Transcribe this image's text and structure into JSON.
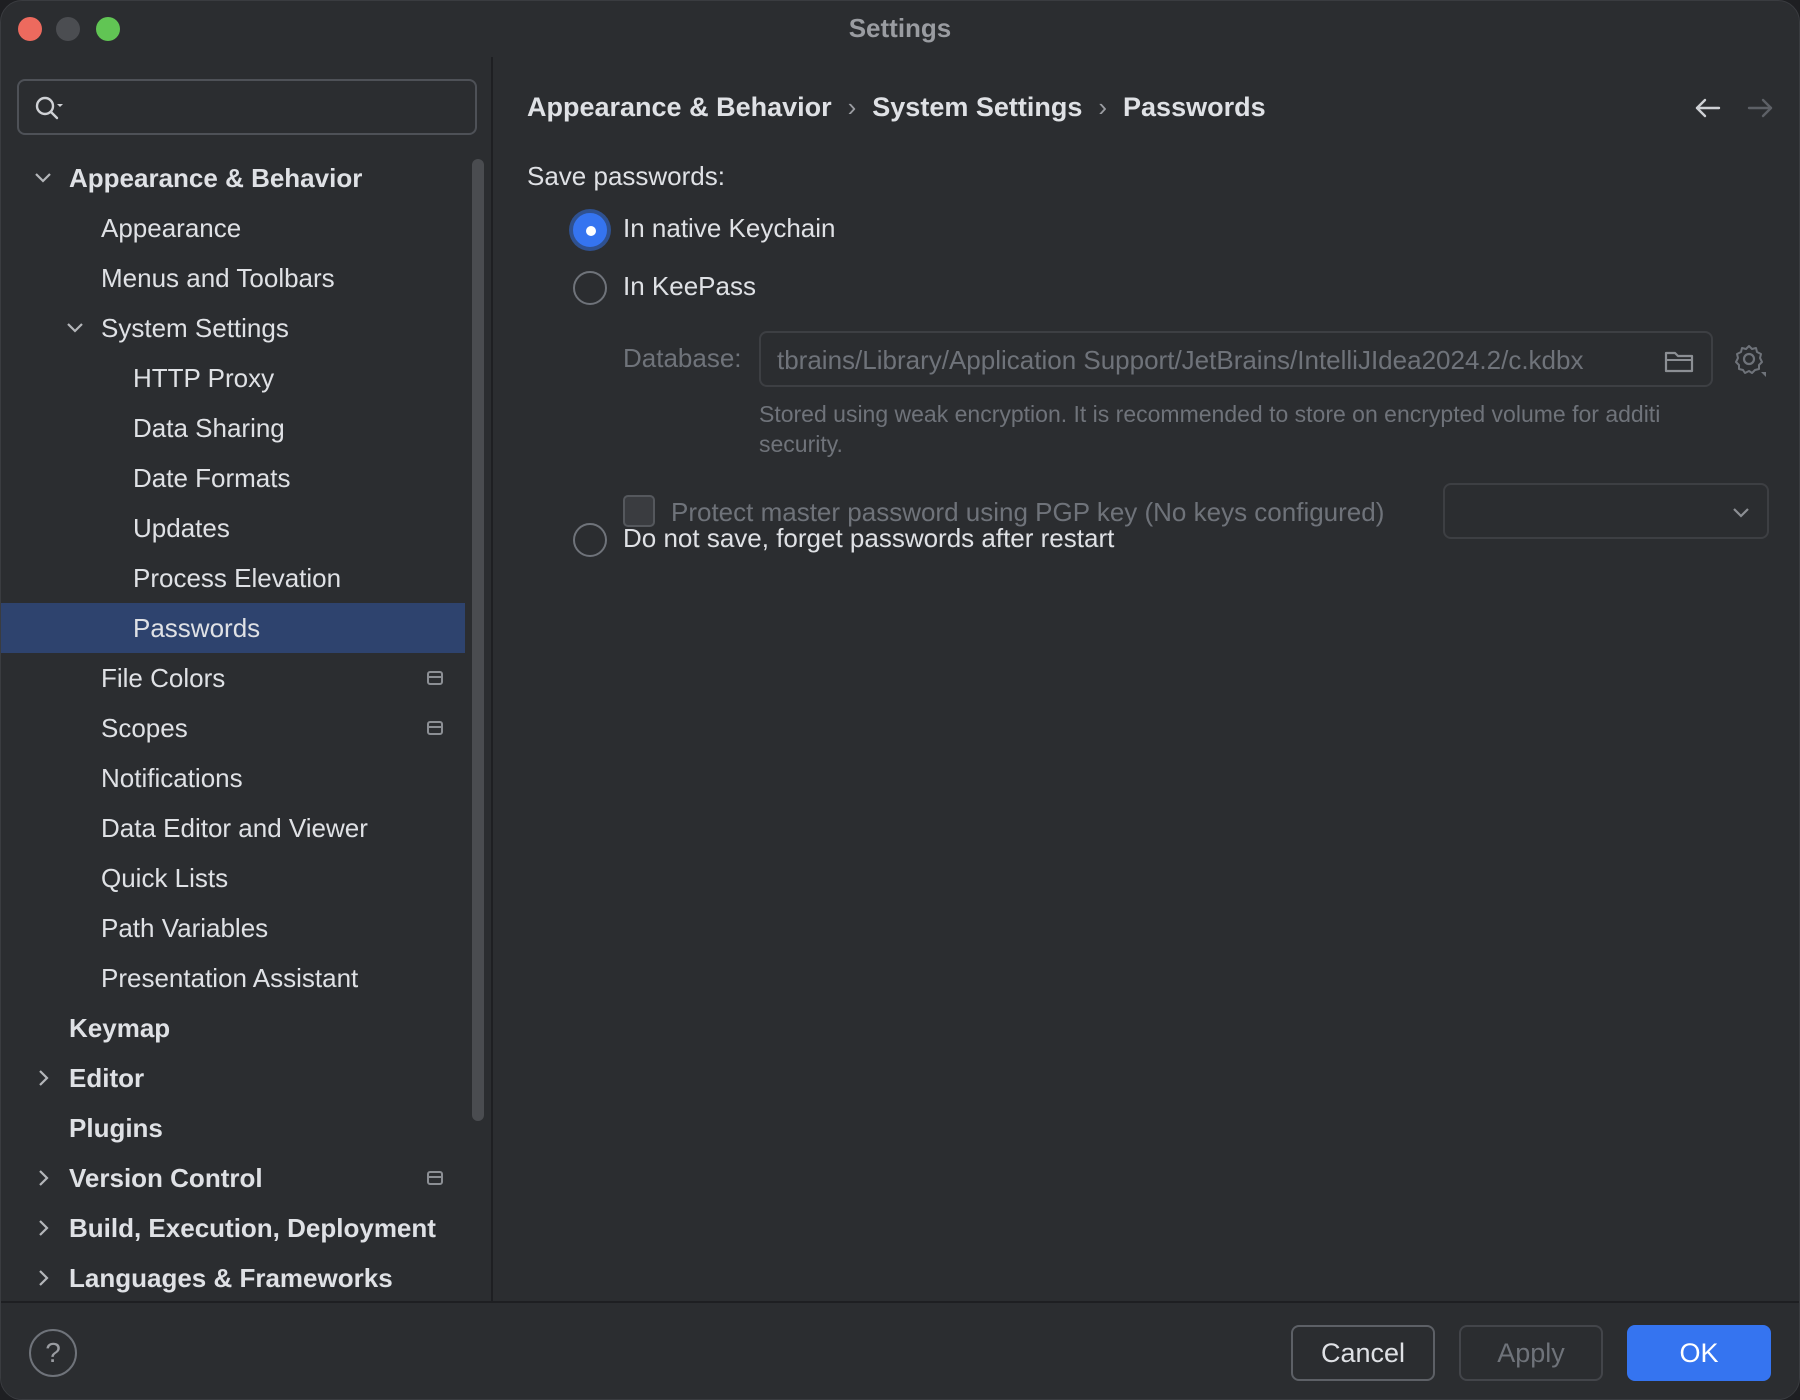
{
  "window": {
    "title": "Settings"
  },
  "search": {
    "placeholder": "",
    "value": ""
  },
  "sidebar": {
    "items": [
      {
        "label": "Appearance & Behavior",
        "level": 0,
        "bold": true,
        "expanded": true
      },
      {
        "label": "Appearance",
        "level": 1
      },
      {
        "label": "Menus and Toolbars",
        "level": 1
      },
      {
        "label": "System Settings",
        "level": 1,
        "expanded": true
      },
      {
        "label": "HTTP Proxy",
        "level": 2
      },
      {
        "label": "Data Sharing",
        "level": 2
      },
      {
        "label": "Date Formats",
        "level": 2
      },
      {
        "label": "Updates",
        "level": 2
      },
      {
        "label": "Process Elevation",
        "level": 2
      },
      {
        "label": "Passwords",
        "level": 2,
        "selected": true
      },
      {
        "label": "File Colors",
        "level": 1,
        "badge": "project-settings-icon"
      },
      {
        "label": "Scopes",
        "level": 1,
        "badge": "project-settings-icon"
      },
      {
        "label": "Notifications",
        "level": 1
      },
      {
        "label": "Data Editor and Viewer",
        "level": 1
      },
      {
        "label": "Quick Lists",
        "level": 1
      },
      {
        "label": "Path Variables",
        "level": 1
      },
      {
        "label": "Presentation Assistant",
        "level": 1
      },
      {
        "label": "Keymap",
        "level": 0,
        "bold": true
      },
      {
        "label": "Editor",
        "level": 0,
        "bold": true,
        "collapsed": true
      },
      {
        "label": "Plugins",
        "level": 0,
        "bold": true
      },
      {
        "label": "Version Control",
        "level": 0,
        "bold": true,
        "collapsed": true,
        "badge": "project-settings-icon"
      },
      {
        "label": "Build, Execution, Deployment",
        "level": 0,
        "bold": true,
        "collapsed": true
      },
      {
        "label": "Languages & Frameworks",
        "level": 0,
        "bold": true,
        "collapsed": true
      }
    ]
  },
  "breadcrumb": {
    "items": [
      "Appearance & Behavior",
      "System Settings",
      "Passwords"
    ],
    "separator": "›"
  },
  "content": {
    "section_label": "Save passwords:",
    "options": {
      "keychain": "In native Keychain",
      "keepass": "In KeePass",
      "no_save": "Do not save, forget passwords after restart"
    },
    "selected_option": "keychain",
    "database_label": "Database:",
    "database_value": "tbrains/Library/Application Support/JetBrains/IntelliJIdea2024.2/c.kdbx",
    "hint_line1": "Stored using weak encryption. It is recommended to store on encrypted volume for additi",
    "hint_line2": "security.",
    "pgp_label": "Protect master password using PGP key (No keys configured)",
    "pgp_selected": ""
  },
  "footer": {
    "help": "?",
    "cancel": "Cancel",
    "apply": "Apply",
    "ok": "OK"
  },
  "colors": {
    "accent": "#3574f0",
    "selection": "#2e436e",
    "background": "#2b2d30"
  }
}
